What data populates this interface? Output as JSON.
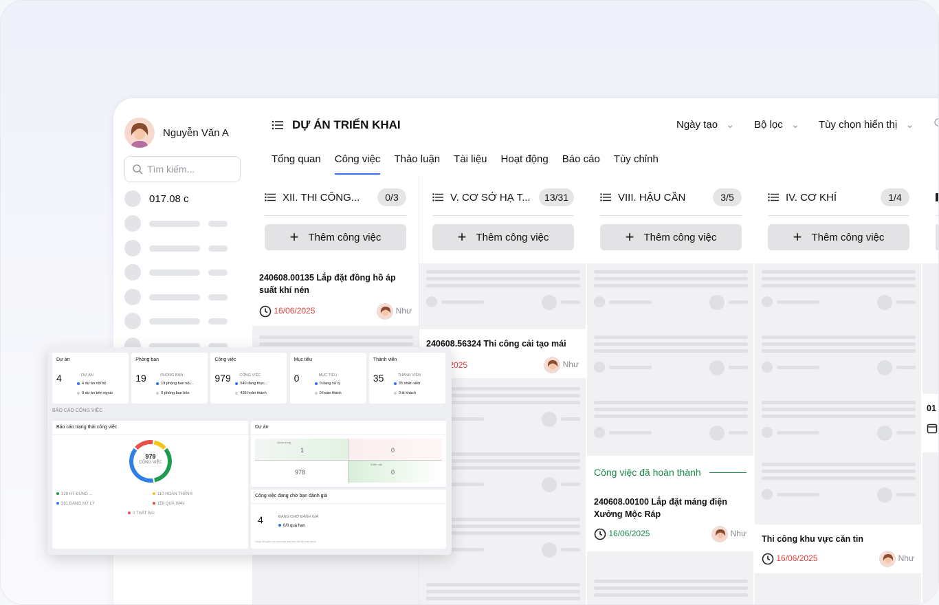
{
  "user": {
    "name": "Nguyễn Văn A"
  },
  "search": {
    "placeholder": "Tìm kiếm..."
  },
  "sidebar": {
    "first_item": "017.08 c"
  },
  "header": {
    "title": "DỰ ÁN TRIỂN KHAI",
    "sort": "Ngày tạo",
    "filter": "Bộ lọc",
    "display": "Tùy chọn hiển thị"
  },
  "tabs": [
    "Tổng quan",
    "Công việc",
    "Thảo luận",
    "Tài liệu",
    "Hoạt động",
    "Báo cáo",
    "Tùy chỉnh"
  ],
  "columns": [
    {
      "name": "XII.  THI CÔNG...",
      "count": "0/3",
      "add": "Thêm công việc"
    },
    {
      "name": "V. CƠ SỞ HẠ T...",
      "count": "13/31",
      "add": "Thêm công việc"
    },
    {
      "name": "VIII. HẬU CẦN",
      "count": "3/5",
      "add": "Thêm công việc"
    },
    {
      "name": "IV. CƠ KHÍ",
      "count": "1/4",
      "add": "Thêm công việc"
    }
  ],
  "cards": {
    "c1": {
      "title": "240608.00135  Lắp đặt đồng hồ áp suất khí nén",
      "date": "16/06/2025",
      "assignee": "Như"
    },
    "c2": {
      "title": "240608.56324  Thi công cải tạo mái",
      "date": "16/06/2025",
      "assignee": "Như"
    },
    "c3": {
      "title": "240608.00100 Lắp đặt máng điện Xưởng Mộc Ráp",
      "date": "16/06/2025",
      "assignee": "Như"
    },
    "c4": {
      "title": "Thi công khu vực căn tin",
      "date": "16/06/2025",
      "assignee": "Như"
    },
    "c5": {
      "title": "01"
    }
  },
  "completed_label": "Công việc đã hoàn thành",
  "colors": {
    "accent": "#2f6ff2",
    "red": "#e0413e",
    "green": "#1a8a4a"
  },
  "dashboard": {
    "stats": [
      {
        "title": "Dự án",
        "value": "4",
        "sub": "DỰ ÁN",
        "l1": "4 dự án nội bộ",
        "l2": "0 dự án bên ngoài"
      },
      {
        "title": "Phòng ban",
        "value": "19",
        "sub": "PHÒNG BAN",
        "l1": "19 phòng ban nội...",
        "l2": "0 phòng ban bên"
      },
      {
        "title": "Công việc",
        "value": "979",
        "sub": "CÔNG VIỆC",
        "l1": "540 đang thực...",
        "l2": "439 hoàn thành"
      },
      {
        "title": "Mục tiêu",
        "value": "0",
        "sub": "MỤC TIÊU",
        "l1": "0 đang xử lý",
        "l2": "0 hoàn thành"
      },
      {
        "title": "Thành viên",
        "value": "35",
        "sub": "THÀNH VIÊN",
        "l1": "35 nhân viên",
        "l2": "0 tk khách"
      }
    ],
    "section": "BÁO CÁO CÔNG VIỆC",
    "status_title": "Báo cáo trạng thái công việc",
    "donut_value": "979",
    "donut_label": "CÔNG VIỆC",
    "legend": [
      "329 HT ĐÚNG ...",
      "110 HOÀN THÀNH",
      "381 ĐANG XỬ LÝ",
      "159 QUÁ HẠN",
      "0 THẤT BẠI"
    ],
    "donut_slices": [
      329,
      110,
      381,
      159,
      0
    ],
    "project_title": "Dự án",
    "matrix_labels": [
      "Quan trọng",
      "Khẩn cấp"
    ],
    "matrix": [
      "1",
      "0",
      "978",
      "0"
    ],
    "review_title": "Công việc đang chờ bạn đánh giá",
    "review_value": "4",
    "review_label": "ĐANG CHỜ ĐÁNH GIÁ",
    "review_sub": "0/0 quá hạn",
    "review_note": "Công việc giao cho bạn hoặc bạn theo dõi đã hoàn thành"
  }
}
